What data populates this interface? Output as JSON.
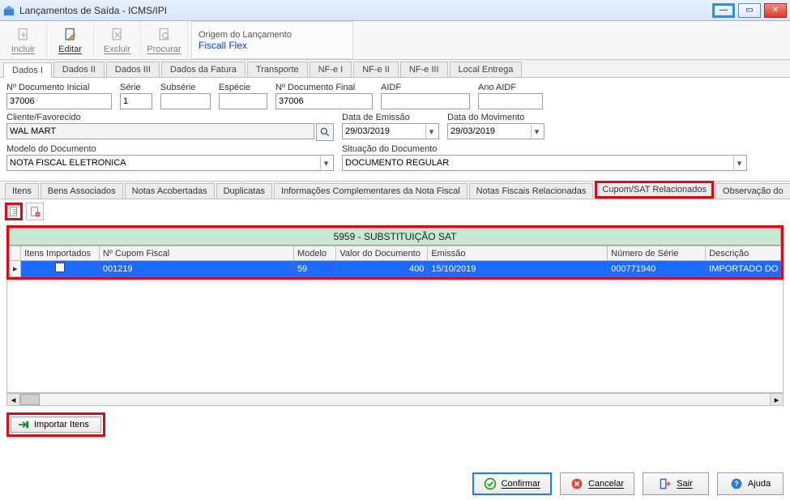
{
  "window": {
    "title": "Lançamentos de Saída - ICMS/IPI"
  },
  "toolbar": {
    "incluir": "Incluir",
    "editar": "Editar",
    "excluir": "Excluir",
    "procurar": "Procurar",
    "origin_caption": "Origem do Lançamento",
    "origin_value": "Fiscall Flex"
  },
  "page_tabs": [
    "Dados I",
    "Dados II",
    "Dados III",
    "Dados da Fatura",
    "Transporte",
    "NF-e I",
    "NF-e II",
    "NF-e III",
    "Local Entrega"
  ],
  "form": {
    "labels": {
      "doc_ini": "Nº Documento Inicial",
      "serie": "Série",
      "subserie": "Subsérie",
      "especie": "Espécie",
      "doc_fim": "Nº Documento Final",
      "aidf": "AIDF",
      "ano_aidf": "Ano AIDF",
      "cliente": "Cliente/Favorecido",
      "emissao": "Data de Emissão",
      "movimento": "Data do Movimento",
      "modelo": "Modelo do Documento",
      "situacao": "Situação do Documento"
    },
    "values": {
      "doc_ini": "37006",
      "serie": "1",
      "subserie": "",
      "especie": "",
      "doc_fim": "37006",
      "aidf": "",
      "ano_aidf": "",
      "cliente": "WAL MART",
      "emissao": "29/03/2019",
      "movimento": "29/03/2019",
      "modelo": "NOTA FISCAL ELETRONICA",
      "situacao": "DOCUMENTO REGULAR"
    }
  },
  "inner_tabs": [
    "Itens",
    "Bens Associados",
    "Notas Acobertadas",
    "Duplicatas",
    "Informações Complementares da Nota Fiscal",
    "Notas Fiscais Relacionadas",
    "Cupom/SAT Relacionados",
    "Observação do"
  ],
  "grid": {
    "group_header": "5959   -   SUBSTITUIÇÃO SAT",
    "columns": [
      "Itens Importados",
      "Nº Cupom Fiscal",
      "Modelo",
      "Valor do Documento",
      "Emissão",
      "Número de Série",
      "Descrição"
    ],
    "row": {
      "itens_importados": false,
      "cupom": "001219",
      "modelo": "59",
      "valor": "400",
      "emissao": "15/10/2019",
      "serie": "000771940",
      "descricao": "IMPORTADO DO X"
    }
  },
  "import_button": "Importar Itens",
  "footer": {
    "confirmar": "Confirmar",
    "cancelar": "Cancelar",
    "sair": "Sair",
    "ajuda": "Ajuda"
  }
}
